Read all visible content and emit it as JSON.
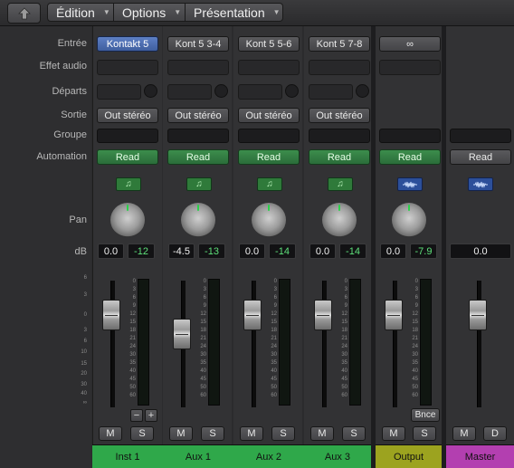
{
  "menubar": {
    "menus": [
      "Édition",
      "Options",
      "Présentation"
    ]
  },
  "row_labels": {
    "input": "Entrée",
    "audio_fx": "Effet audio",
    "sends": "Départs",
    "output": "Sortie",
    "group": "Groupe",
    "automation": "Automation",
    "pan": "Pan",
    "db": "dB"
  },
  "fader_scale": [
    "6",
    "3",
    "0",
    "3",
    "6",
    "10",
    "15",
    "20",
    "30",
    "40",
    "∞"
  ],
  "meter_scale": [
    "0",
    "3",
    "6",
    "9",
    "12",
    "15",
    "18",
    "21",
    "24",
    "30",
    "35",
    "40",
    "45",
    "50",
    "60"
  ],
  "channels": [
    {
      "name": "Inst 1",
      "input": "Kontakt 5",
      "input_style": "blue",
      "output": "Out stéréo",
      "automation": "Read",
      "automation_style": "green",
      "icon": "midi-note-icon",
      "volume_db": "0.0",
      "peak_db": "-12",
      "solo_label": "S",
      "mute_label": "M",
      "color": "#2fa84a"
    },
    {
      "name": "Aux 1",
      "input": "Kont 5 3-4",
      "input_style": "grey",
      "output": "Out stéréo",
      "automation": "Read",
      "automation_style": "green",
      "icon": "midi-note-icon",
      "volume_db": "-4.5",
      "peak_db": "-13",
      "solo_label": "S",
      "mute_label": "M",
      "color": "#2fa84a"
    },
    {
      "name": "Aux 2",
      "input": "Kont 5 5-6",
      "input_style": "grey",
      "output": "Out stéréo",
      "automation": "Read",
      "automation_style": "green",
      "icon": "midi-note-icon",
      "volume_db": "0.0",
      "peak_db": "-14",
      "solo_label": "S",
      "mute_label": "M",
      "color": "#2fa84a"
    },
    {
      "name": "Aux 3",
      "input": "Kont 5 7-8",
      "input_style": "grey",
      "output": "Out stéréo",
      "automation": "Read",
      "automation_style": "green",
      "icon": "midi-note-icon",
      "volume_db": "0.0",
      "peak_db": "-14",
      "solo_label": "S",
      "mute_label": "M",
      "color": "#2fa84a"
    },
    {
      "name": "Output",
      "input": "∞",
      "input_style": "grey",
      "output": "",
      "automation": "Read",
      "automation_style": "green",
      "icon": "waveform-icon",
      "volume_db": "0.0",
      "peak_db": "-7.9",
      "solo_label": "S",
      "mute_label": "M",
      "bounce_label": "Bnce",
      "color": "#9ca31f"
    },
    {
      "name": "Master",
      "automation": "Read",
      "automation_style": "grey",
      "icon": "waveform-icon",
      "volume_db": "0.0",
      "mute_label": "M",
      "dim_label": "D",
      "color": "#b33fb0"
    }
  ],
  "fader_levels_db": [
    0.0,
    -4.5,
    0.0,
    0.0,
    0.0,
    0.0
  ],
  "plus_minus": {
    "minus": "−",
    "plus": "+"
  }
}
